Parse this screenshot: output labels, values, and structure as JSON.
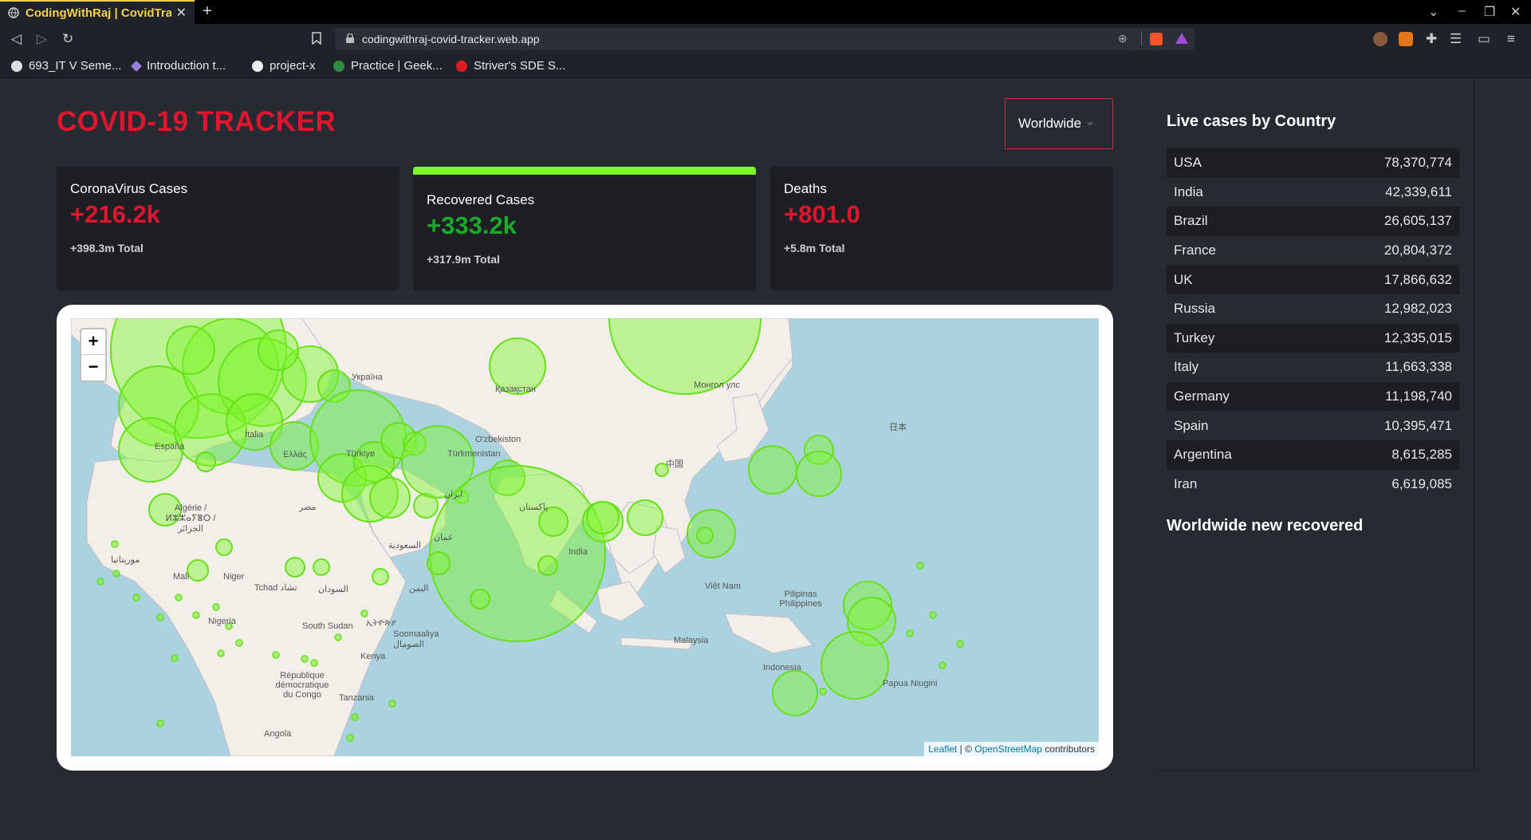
{
  "browser": {
    "tab_title": "CodingWithRaj | CovidTracker",
    "url": "codingwithraj-covid-tracker.web.app",
    "bookmarks": [
      "693_IT V Seme...",
      "Introduction t...",
      "project-x",
      "Practice | Geek...",
      "Striver's SDE S..."
    ]
  },
  "app": {
    "title": "COVID-19 TRACKER",
    "country_select": "Worldwide"
  },
  "cards": [
    {
      "label": "CoronaVirus Cases",
      "value": "+216.2k",
      "total": "+398.3m Total"
    },
    {
      "label": "Recovered Cases",
      "value": "+333.2k",
      "total": "+317.9m Total"
    },
    {
      "label": "Deaths",
      "value": "+801.0",
      "total": "+5.8m Total"
    }
  ],
  "map": {
    "zoom_in": "+",
    "zoom_out": "−",
    "attr_leaflet": "Leaflet",
    "attr_sep": " | © ",
    "attr_osm": "OpenStreetMap",
    "attr_contrib": " contributors",
    "labels": [
      "Україна",
      "Қазақстан",
      "Монгол улс",
      "España",
      "Türkiye",
      "Italia",
      "Ελλάς",
      "O'zbekiston",
      "Türkmenistan",
      "中国",
      "日本",
      "ایران",
      "پاکستان",
      "India",
      "Việt Nam",
      "Pilipinas Philippines",
      "Algérie / ⵍⵣⵣⴰⵢⴻⵔ / الجزائر",
      "Mali",
      "Niger",
      "Tchad تشاد",
      "السودان",
      "السعودية",
      "اليمن",
      "Nigeria",
      "South Sudan",
      "Soomaaliya الصومال",
      "République démocratique du Congo",
      "Kenya",
      "Tanzania",
      "Angola",
      "Malaysia",
      "Indonesia",
      "Papua Niugini",
      "موريتانيا",
      "مصر",
      "ኢትዮጵያ",
      "عمان"
    ]
  },
  "sidebar": {
    "title": "Live cases by Country",
    "countries": [
      {
        "name": "USA",
        "cases": "78,370,774"
      },
      {
        "name": "India",
        "cases": "42,339,611"
      },
      {
        "name": "Brazil",
        "cases": "26,605,137"
      },
      {
        "name": "France",
        "cases": "20,804,372"
      },
      {
        "name": "UK",
        "cases": "17,866,632"
      },
      {
        "name": "Russia",
        "cases": "12,982,023"
      },
      {
        "name": "Turkey",
        "cases": "12,335,015"
      },
      {
        "name": "Italy",
        "cases": "11,663,338"
      },
      {
        "name": "Germany",
        "cases": "11,198,740"
      },
      {
        "name": "Spain",
        "cases": "10,395,471"
      },
      {
        "name": "Argentina",
        "cases": "8,615,285"
      },
      {
        "name": "Iran",
        "cases": "6,619,085"
      }
    ],
    "chart_title": "Worldwide new recovered"
  },
  "colors": {
    "accent_red": "#e0152e",
    "accent_green": "#7cf72b",
    "recovered_green": "#1bab2a"
  }
}
